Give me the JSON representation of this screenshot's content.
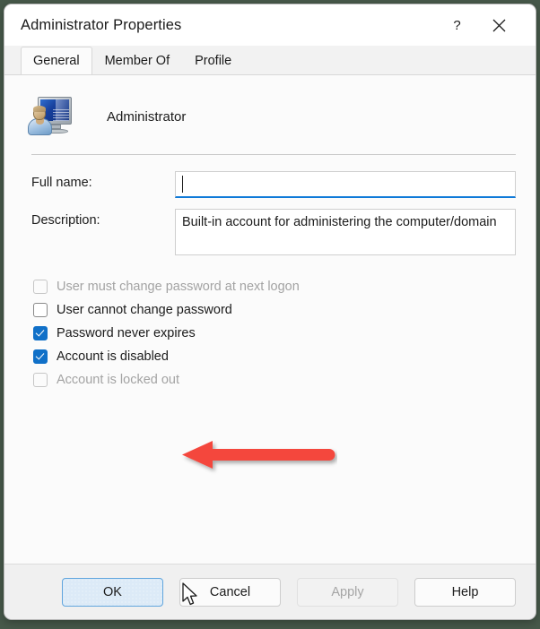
{
  "window": {
    "title": "Administrator Properties",
    "help_icon": "question-mark-icon",
    "close_icon": "close-x-icon"
  },
  "tabs": [
    {
      "label": "General",
      "selected": true
    },
    {
      "label": "Member Of",
      "selected": false
    },
    {
      "label": "Profile",
      "selected": false
    }
  ],
  "account": {
    "icon": "user-account-icon",
    "name": "Administrator"
  },
  "fields": [
    {
      "label": "Full name:",
      "value": "",
      "focused": true
    },
    {
      "label": "Description:",
      "value": "Built-in account for administering the computer/domain",
      "focused": false
    }
  ],
  "checkboxes": [
    {
      "label": "User must change password at next logon",
      "checked": false,
      "disabled": true
    },
    {
      "label": "User cannot change password",
      "checked": false,
      "disabled": false
    },
    {
      "label": "Password never expires",
      "checked": true,
      "disabled": false
    },
    {
      "label": "Account is disabled",
      "checked": true,
      "disabled": false
    },
    {
      "label": "Account is locked out",
      "checked": false,
      "disabled": true
    }
  ],
  "annotation": {
    "type": "arrow",
    "direction": "left",
    "color": "#f4473e",
    "points_to": "Account is disabled"
  },
  "buttons": [
    {
      "label": "OK",
      "state": "default"
    },
    {
      "label": "Cancel",
      "state": "normal"
    },
    {
      "label": "Apply",
      "state": "disabled"
    },
    {
      "label": "Help",
      "state": "normal"
    }
  ],
  "cursor": {
    "type": "arrow-pointer",
    "over": "OK"
  },
  "colors": {
    "accent": "#0f7ad8",
    "checkbox_checked": "#1070c8",
    "default_button_fill": "#dceaf7",
    "default_button_border": "#60a5dd",
    "annotation_red": "#f4473e",
    "desktop_background": "#47594a"
  }
}
